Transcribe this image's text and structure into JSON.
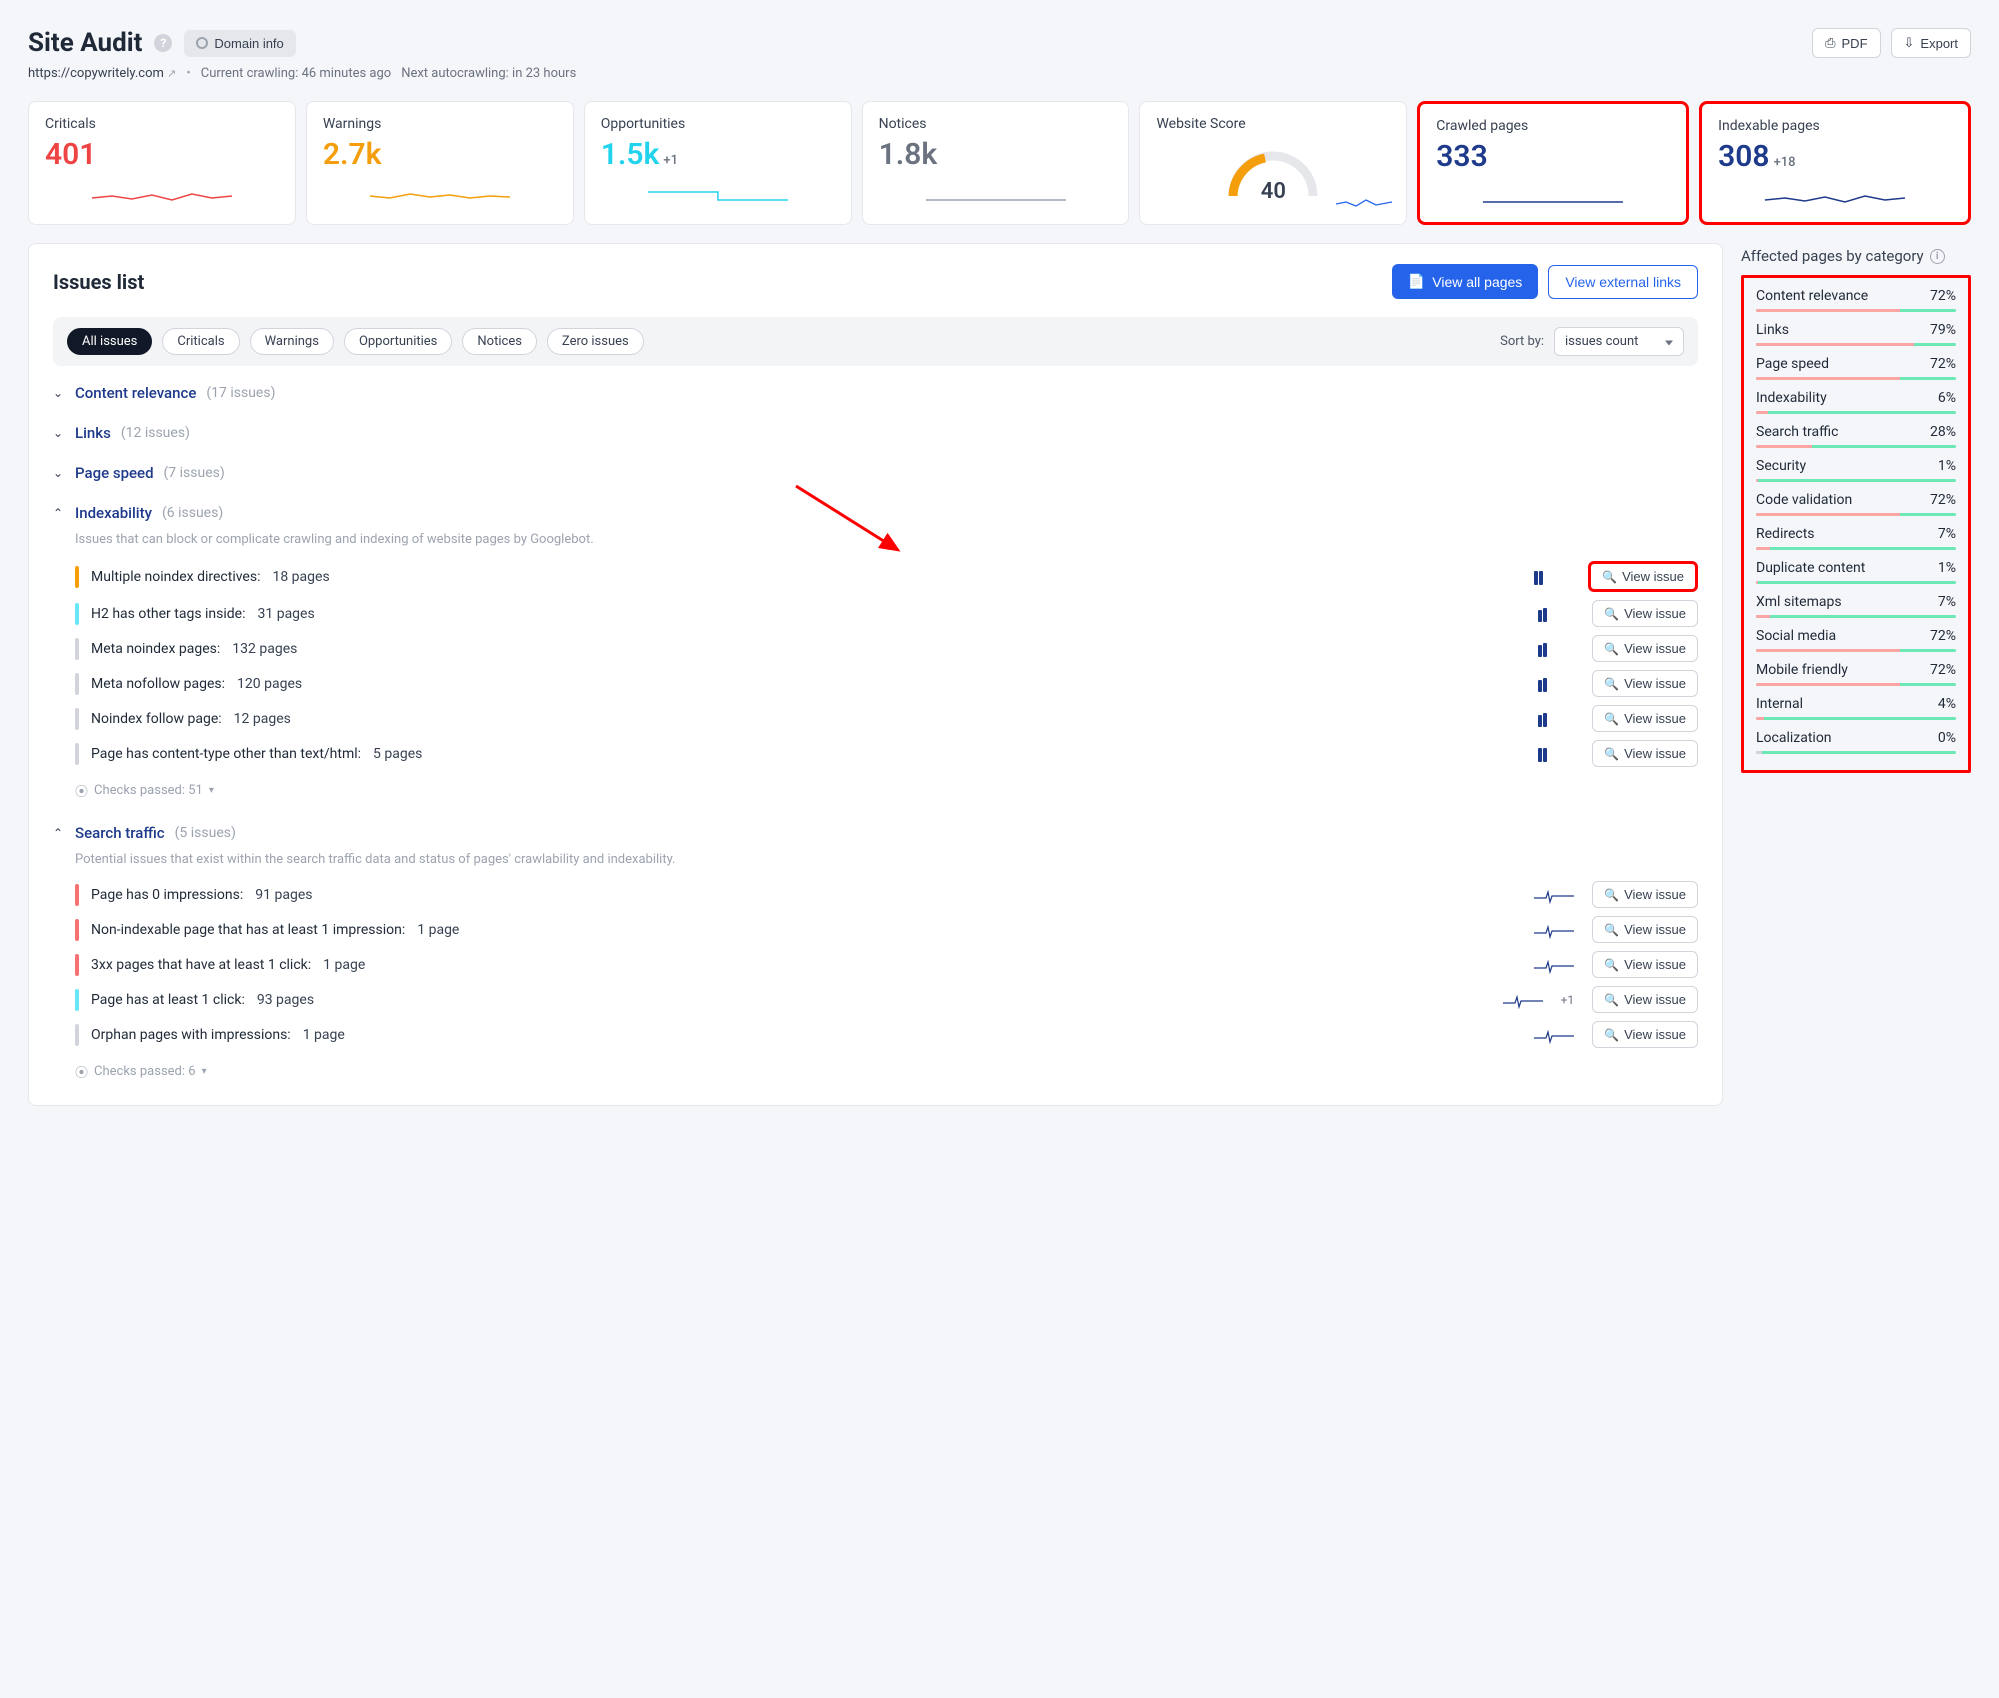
{
  "header": {
    "title": "Site Audit",
    "domain_info_label": "Domain info",
    "url": "https://copywritely.com",
    "crawling_status": "Current crawling: 46 minutes ago",
    "next_autocrawl": "Next autocrawling: in 23 hours",
    "pdf_label": "PDF",
    "export_label": "Export"
  },
  "metrics": {
    "criticals": {
      "label": "Criticals",
      "value": "401",
      "color": "#ef4444"
    },
    "warnings": {
      "label": "Warnings",
      "value": "2.7k",
      "color": "#f59e0b"
    },
    "opportunities": {
      "label": "Opportunities",
      "value": "1.5k",
      "delta": "+1",
      "color": "#22d3ee"
    },
    "notices": {
      "label": "Notices",
      "value": "1.8k",
      "color": "#6b7280"
    },
    "website_score": {
      "label": "Website Score",
      "value": "40"
    },
    "crawled": {
      "label": "Crawled pages",
      "value": "333",
      "color": "#1e3a8a"
    },
    "indexable": {
      "label": "Indexable pages",
      "value": "308",
      "delta": "+18",
      "color": "#1e3a8a"
    }
  },
  "issues": {
    "title": "Issues list",
    "view_all_label": "View all pages",
    "view_external_label": "View external links",
    "filters": [
      "All issues",
      "Criticals",
      "Warnings",
      "Opportunities",
      "Notices",
      "Zero issues"
    ],
    "active_filter": "All issues",
    "sort_label": "Sort by:",
    "sort_value": "issues count",
    "view_issue_label": "View issue",
    "checks_passed_prefix": "Checks passed:",
    "sections": [
      {
        "name": "Content relevance",
        "count_label": "(17 issues)",
        "expanded": false
      },
      {
        "name": "Links",
        "count_label": "(12 issues)",
        "expanded": false
      },
      {
        "name": "Page speed",
        "count_label": "(7 issues)",
        "expanded": false
      },
      {
        "name": "Indexability",
        "count_label": "(6 issues)",
        "expanded": true,
        "description": "Issues that can block or complicate crawling and indexing of website pages by Googlebot.",
        "items": [
          {
            "name": "Multiple noindex directives:",
            "pages": "18 pages",
            "severity": "#f59e0b",
            "bars": [
              14,
              14
            ]
          },
          {
            "name": "H2 has other tags inside:",
            "pages": "31 pages",
            "severity": "#67e8f9",
            "bars": [
              12,
              14
            ]
          },
          {
            "name": "Meta noindex pages:",
            "pages": "132 pages",
            "severity": "#d1d5db",
            "bars": [
              12,
              14
            ]
          },
          {
            "name": "Meta nofollow pages:",
            "pages": "120 pages",
            "severity": "#d1d5db",
            "bars": [
              12,
              14
            ]
          },
          {
            "name": "Noindex follow page:",
            "pages": "12 pages",
            "severity": "#d1d5db",
            "bars": [
              12,
              14
            ]
          },
          {
            "name": "Page has content-type other than text/html:",
            "pages": "5 pages",
            "severity": "#d1d5db",
            "bars": [
              14,
              14
            ]
          }
        ],
        "checks_passed": "51"
      },
      {
        "name": "Search traffic",
        "count_label": "(5 issues)",
        "expanded": true,
        "description": "Potential issues that exist within the search traffic data and status of pages' crawlability and indexability.",
        "items": [
          {
            "name": "Page has 0 impressions:",
            "pages": "91 pages",
            "severity": "#f87171",
            "spark": true
          },
          {
            "name": "Non-indexable page that has at least 1 impression:",
            "pages": "1 page",
            "severity": "#f87171",
            "spark": true
          },
          {
            "name": "3xx pages that have at least 1 click:",
            "pages": "1 page",
            "severity": "#f87171",
            "spark": true
          },
          {
            "name": "Page has at least 1 click:",
            "pages": "93 pages",
            "severity": "#67e8f9",
            "spark": true,
            "plus": "+1"
          },
          {
            "name": "Orphan pages with impressions:",
            "pages": "1 page",
            "severity": "#d1d5db",
            "spark": true
          }
        ],
        "checks_passed": "6"
      }
    ]
  },
  "categories": {
    "title": "Affected pages by category",
    "items": [
      {
        "name": "Content relevance",
        "pct": "72%",
        "pctNum": 72
      },
      {
        "name": "Links",
        "pct": "79%",
        "pctNum": 79
      },
      {
        "name": "Page speed",
        "pct": "72%",
        "pctNum": 72
      },
      {
        "name": "Indexability",
        "pct": "6%",
        "pctNum": 6
      },
      {
        "name": "Search traffic",
        "pct": "28%",
        "pctNum": 28
      },
      {
        "name": "Security",
        "pct": "1%",
        "pctNum": 1
      },
      {
        "name": "Code validation",
        "pct": "72%",
        "pctNum": 72
      },
      {
        "name": "Redirects",
        "pct": "7%",
        "pctNum": 7
      },
      {
        "name": "Duplicate content",
        "pct": "1%",
        "pctNum": 1
      },
      {
        "name": "Xml sitemaps",
        "pct": "7%",
        "pctNum": 7
      },
      {
        "name": "Social media",
        "pct": "72%",
        "pctNum": 72
      },
      {
        "name": "Mobile friendly",
        "pct": "72%",
        "pctNum": 72
      },
      {
        "name": "Internal",
        "pct": "4%",
        "pctNum": 4
      },
      {
        "name": "Localization",
        "pct": "0%",
        "pctNum": 0,
        "zero": true
      }
    ]
  }
}
